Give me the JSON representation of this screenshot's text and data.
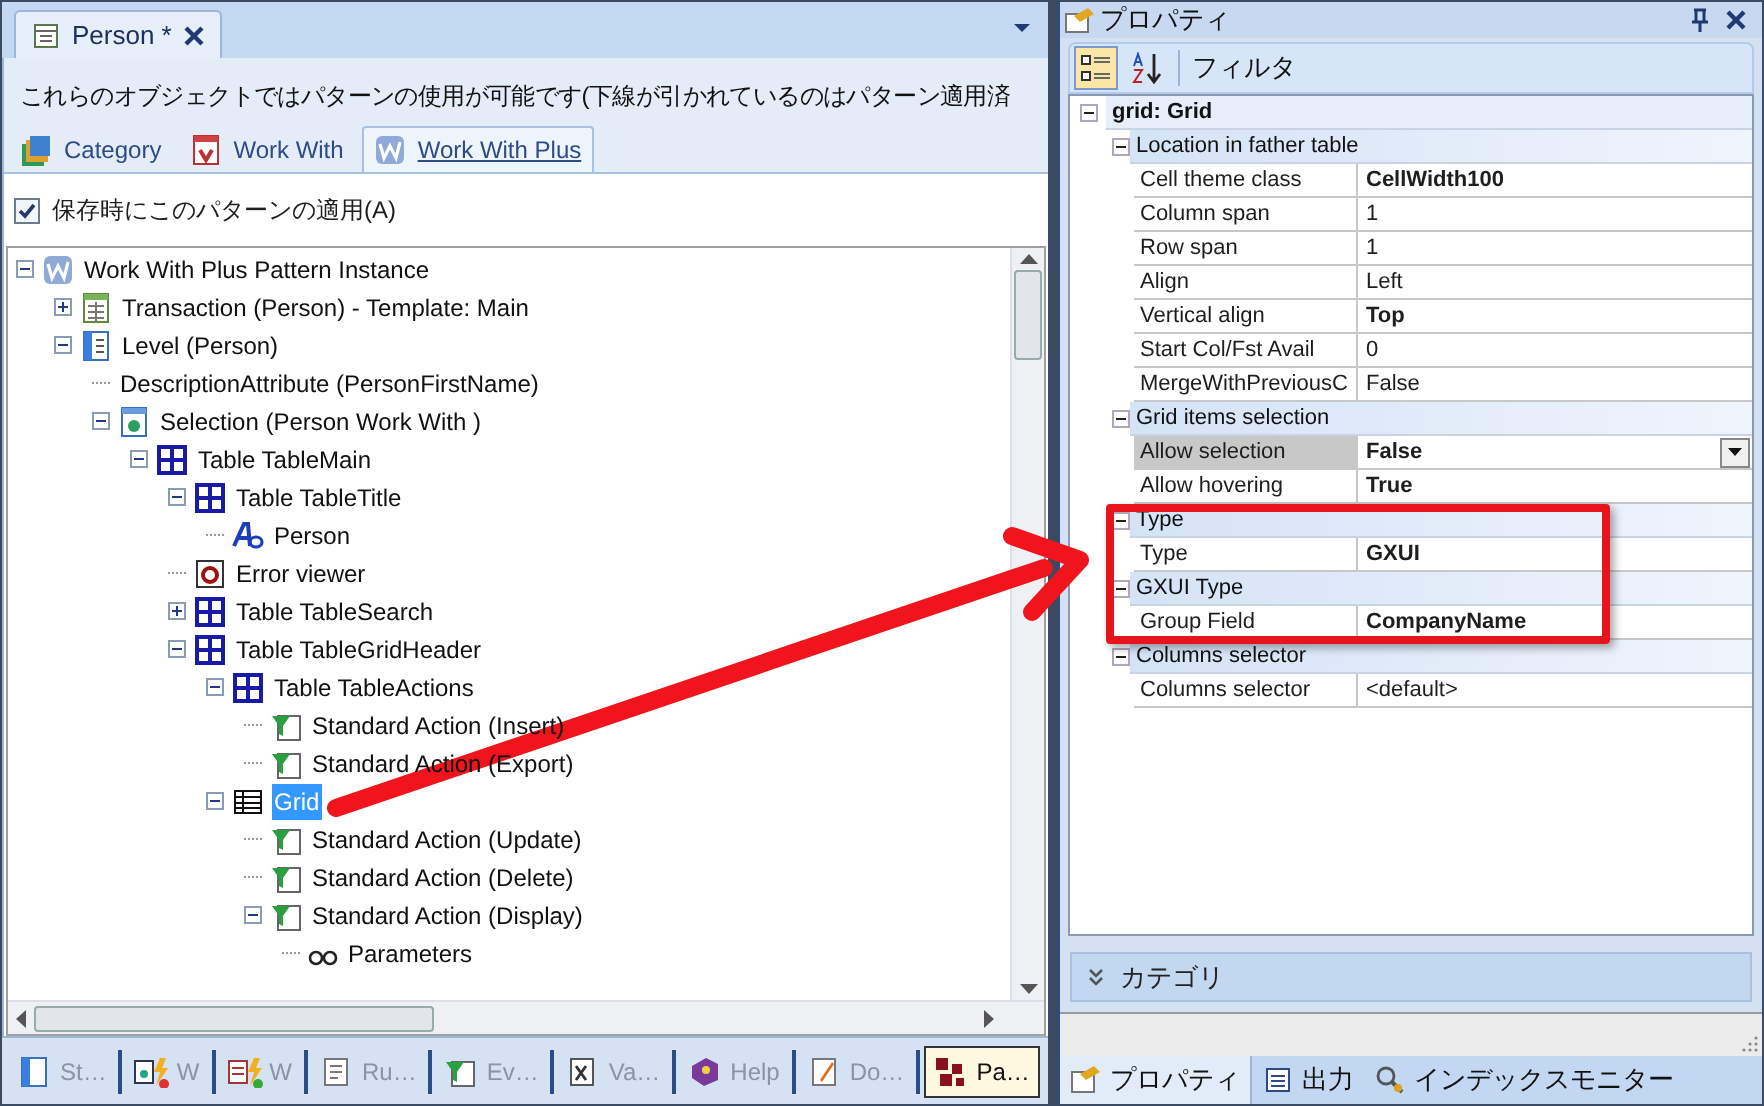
{
  "editor_tab": {
    "title": "Person *",
    "modified": true
  },
  "description": "これらのオブジェクトではパターンの使用が可能です(下線が引かれているのはパターン適用済",
  "pattern_tabs": [
    {
      "label": "Category",
      "kind": "category",
      "selected": false
    },
    {
      "label": "Work With",
      "kind": "workwith",
      "selected": false
    },
    {
      "label": "Work With Plus",
      "kind": "workwithplus",
      "selected": true
    }
  ],
  "apply_on_save": {
    "label": "保存時にこのパターンの適用(A)",
    "checked": true
  },
  "tree": [
    {
      "label": "Work With Plus Pattern Instance",
      "kind": "pattern",
      "expanded": true,
      "selected": false,
      "children": [
        {
          "label": "Transaction (Person) - Template: Main",
          "kind": "transaction",
          "expanded": false,
          "selected": false
        },
        {
          "label": "Level (Person)",
          "kind": "level",
          "expanded": true,
          "selected": false,
          "children": [
            {
              "label": "DescriptionAttribute (PersonFirstName)",
              "kind": "attribute",
              "selected": false
            },
            {
              "label": "Selection (Person Work With )",
              "kind": "selection",
              "expanded": true,
              "selected": false,
              "children": [
                {
                  "label": "Table TableMain",
                  "kind": "table",
                  "expanded": true,
                  "selected": false,
                  "children": [
                    {
                      "label": "Table TableTitle",
                      "kind": "table",
                      "expanded": true,
                      "selected": false,
                      "children": [
                        {
                          "label": "Person",
                          "kind": "text",
                          "selected": false
                        }
                      ]
                    },
                    {
                      "label": "Error viewer",
                      "kind": "error",
                      "selected": false
                    },
                    {
                      "label": "Table TableSearch",
                      "kind": "table",
                      "expanded": false,
                      "selected": false
                    },
                    {
                      "label": "Table TableGridHeader",
                      "kind": "table",
                      "expanded": true,
                      "selected": false,
                      "children": [
                        {
                          "label": "Table TableActions",
                          "kind": "table",
                          "expanded": true,
                          "selected": false,
                          "children": [
                            {
                              "label": "Standard Action (Insert)",
                              "kind": "action",
                              "selected": false
                            },
                            {
                              "label": "Standard Action (Export)",
                              "kind": "action",
                              "selected": false
                            }
                          ]
                        },
                        {
                          "label": "Grid",
                          "kind": "grid",
                          "expanded": true,
                          "selected": true,
                          "children": [
                            {
                              "label": "Standard Action (Update)",
                              "kind": "action",
                              "selected": false
                            },
                            {
                              "label": "Standard Action (Delete)",
                              "kind": "action",
                              "selected": false
                            },
                            {
                              "label": "Standard Action (Display)",
                              "kind": "action",
                              "expanded": true,
                              "selected": false,
                              "children": [
                                {
                                  "label": "Parameters",
                                  "kind": "parameters",
                                  "selected": false
                                }
                              ]
                            }
                          ]
                        }
                      ]
                    }
                  ]
                }
              ]
            }
          ]
        }
      ]
    }
  ],
  "bottom_tabs": [
    {
      "label": "St…",
      "kind": "structure",
      "selected": false
    },
    {
      "label": "W",
      "kind": "webform",
      "selected": false
    },
    {
      "label": "W",
      "kind": "winform",
      "selected": false
    },
    {
      "label": "Ru…",
      "kind": "rules",
      "selected": false
    },
    {
      "label": "Ev…",
      "kind": "events",
      "selected": false
    },
    {
      "label": "Va…",
      "kind": "variables",
      "selected": false
    },
    {
      "label": "Help",
      "kind": "help",
      "selected": false
    },
    {
      "label": "Do…",
      "kind": "documentation",
      "selected": false
    },
    {
      "label": "Pa…",
      "kind": "patterns",
      "selected": true
    }
  ],
  "properties": {
    "title": "プロパティ",
    "toolbar": [
      {
        "kind": "categorized",
        "selected": true
      },
      {
        "kind": "alphabetical",
        "selected": false
      }
    ],
    "filter": "フィルタ",
    "root": {
      "label": "grid: Grid",
      "expanded": true,
      "groups": [
        {
          "label": "Location in father table",
          "expanded": true,
          "rows": [
            {
              "name": "Cell theme class",
              "value": "CellWidth100",
              "modified": true,
              "selected": false
            },
            {
              "name": "Column span",
              "value": "1",
              "modified": false,
              "selected": false
            },
            {
              "name": "Row span",
              "value": "1",
              "modified": false,
              "selected": false
            },
            {
              "name": "Align",
              "value": "Left",
              "modified": false,
              "selected": false
            },
            {
              "name": "Vertical align",
              "value": "Top",
              "modified": true,
              "selected": false
            },
            {
              "name": "Start Col/Fst Avail",
              "value": "0",
              "modified": false,
              "selected": false
            },
            {
              "name": "MergeWithPreviousC",
              "value": "False",
              "modified": false,
              "selected": false
            }
          ]
        },
        {
          "label": "Grid items selection",
          "expanded": true,
          "rows": [
            {
              "name": "Allow selection",
              "value": "False",
              "modified": true,
              "selected": true
            },
            {
              "name": "Allow hovering",
              "value": "True",
              "modified": true,
              "selected": false
            }
          ]
        },
        {
          "label": "Type",
          "expanded": true,
          "rows": [
            {
              "name": "Type",
              "value": "GXUI",
              "modified": true,
              "selected": false
            }
          ]
        },
        {
          "label": "GXUI Type",
          "expanded": true,
          "rows": [
            {
              "name": "Group Field",
              "value": "CompanyName",
              "modified": true,
              "selected": false
            }
          ]
        },
        {
          "label": "Columns selector",
          "expanded": true,
          "rows": [
            {
              "name": "Columns selector",
              "value": "<default>",
              "modified": false,
              "selected": false
            }
          ]
        }
      ]
    },
    "category_bar": "カテゴリ"
  },
  "panel_tabs": [
    {
      "label": "プロパティ",
      "kind": "properties",
      "selected": true
    },
    {
      "label": "出力",
      "kind": "output",
      "selected": false
    },
    {
      "label": "インデックスモニター",
      "kind": "indexmonitor",
      "selected": false
    }
  ],
  "annotations": {
    "highlight_frame": true,
    "arrow": true
  }
}
